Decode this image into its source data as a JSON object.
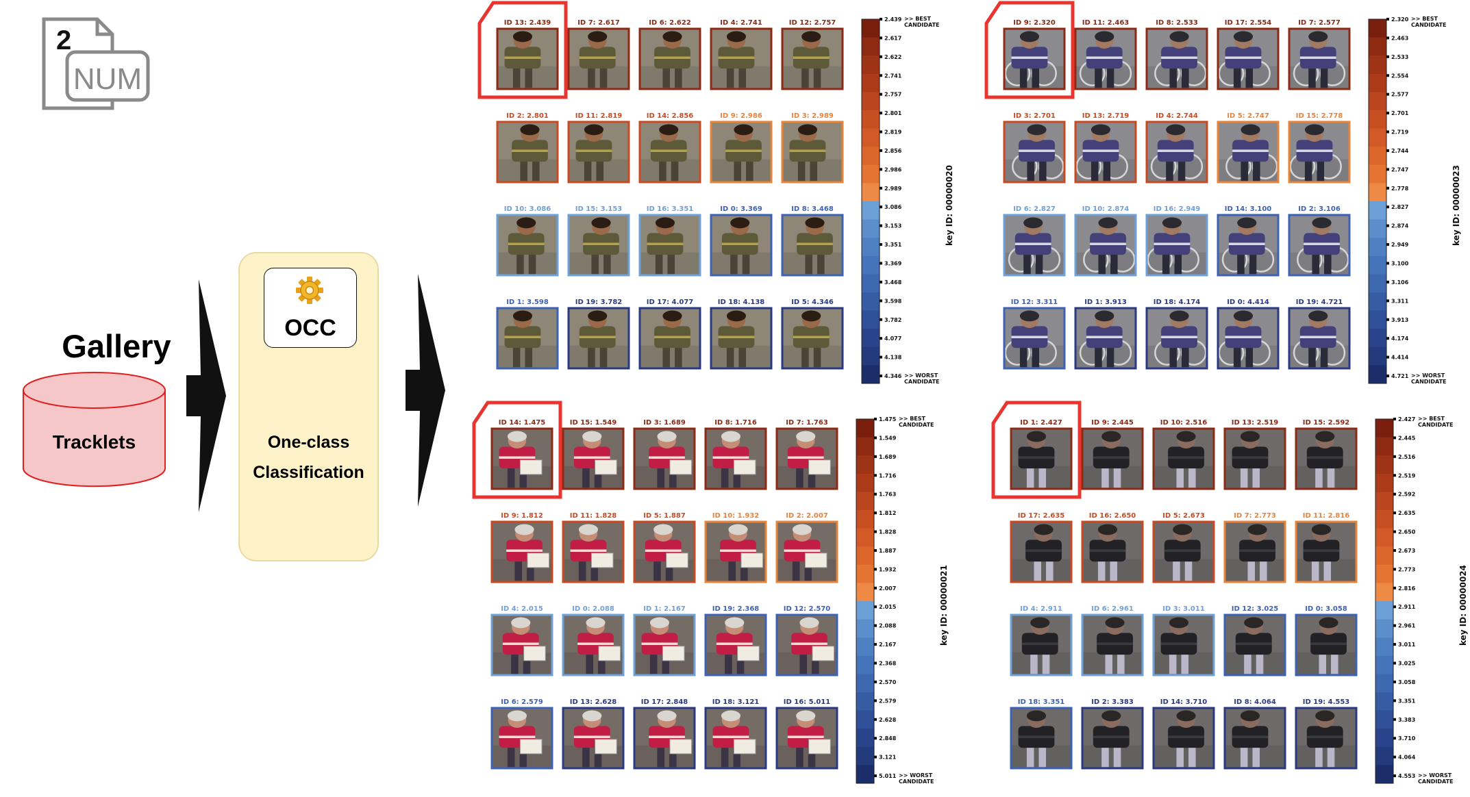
{
  "badge": {
    "number": "2",
    "text": "NUM"
  },
  "gallery": {
    "title": "Gallery",
    "db_label": "Tracklets"
  },
  "occ": {
    "chip_label": "OCC",
    "line1": "One-class",
    "line2": "Classification"
  },
  "colorbar": {
    "best_label_1": ">> BEST",
    "best_label_2": "CANDIDATE",
    "worst_label_1": ">> WORST",
    "worst_label_2": "CANDIDATE"
  },
  "colors": {
    "border_dark_red": "#8b2a15",
    "border_red": "#c84a22",
    "border_orange": "#e8833a",
    "border_light_blue": "#6fa0d6",
    "border_blue": "#3c62b4",
    "border_navy": "#2a3a82",
    "highlight": "#e8352f"
  },
  "panels": [
    {
      "key_id": "key ID: 00000020",
      "theme": "brown",
      "cells": [
        [
          "ID 13:  2.439",
          "ID 7:  2.617",
          "ID 6:  2.622",
          "ID 4:  2.741",
          "ID 12:  2.757"
        ],
        [
          "ID 2:  2.801",
          "ID 11:  2.819",
          "ID 14:  2.856",
          "ID 9:  2.986",
          "ID 3:  2.989"
        ],
        [
          "ID 10:  3.086",
          "ID 15:  3.153",
          "ID 16:  3.351",
          "ID 0:  3.369",
          "ID 8:  3.468"
        ],
        [
          "ID 1:  3.598",
          "ID 19:  3.782",
          "ID 17:  4.077",
          "ID 18:  4.138",
          "ID 5:  4.346"
        ]
      ],
      "ticks": [
        "2.439",
        "2.617",
        "2.622",
        "2.741",
        "2.757",
        "2.801",
        "2.819",
        "2.856",
        "2.986",
        "2.989",
        "3.086",
        "3.153",
        "3.351",
        "3.369",
        "3.468",
        "3.598",
        "3.782",
        "4.077",
        "4.138",
        "4.346"
      ]
    },
    {
      "key_id": "key ID: 00000023",
      "theme": "bike",
      "cells": [
        [
          "ID 9:  2.320",
          "ID 11:  2.463",
          "ID 8:  2.533",
          "ID 17:  2.554",
          "ID 7:  2.577"
        ],
        [
          "ID 3:  2.701",
          "ID 13:  2.719",
          "ID 4:  2.744",
          "ID 5:  2.747",
          "ID 15:  2.778"
        ],
        [
          "ID 6:  2.827",
          "ID 10:  2.874",
          "ID 16:  2.949",
          "ID 14:  3.100",
          "ID 2:  3.106"
        ],
        [
          "ID 12:  3.311",
          "ID 1:  3.913",
          "ID 18:  4.174",
          "ID 0:  4.414",
          "ID 19:  4.721"
        ]
      ],
      "ticks": [
        "2.320",
        "2.463",
        "2.533",
        "2.554",
        "2.577",
        "2.701",
        "2.719",
        "2.744",
        "2.747",
        "2.778",
        "2.827",
        "2.874",
        "2.949",
        "3.100",
        "3.106",
        "3.311",
        "3.913",
        "4.174",
        "4.414",
        "4.721"
      ]
    },
    {
      "key_id": "key ID: 00000021",
      "theme": "red",
      "cells": [
        [
          "ID 14:  1.475",
          "ID 15:  1.549",
          "ID 3:  1.689",
          "ID 8:  1.716",
          "ID 7:  1.763"
        ],
        [
          "ID 9:  1.812",
          "ID 11:  1.828",
          "ID 5:  1.887",
          "ID 10:  1.932",
          "ID 2:  2.007"
        ],
        [
          "ID 4:  2.015",
          "ID 0:  2.088",
          "ID 1:  2.167",
          "ID 19:  2.368",
          "ID 12:  2.570"
        ],
        [
          "ID 6:  2.579",
          "ID 13:  2.628",
          "ID 17:  2.848",
          "ID 18:  3.121",
          "ID 16:  5.011"
        ]
      ],
      "ticks": [
        "1.475",
        "1.549",
        "1.689",
        "1.716",
        "1.763",
        "1.812",
        "1.828",
        "1.887",
        "1.932",
        "2.007",
        "2.015",
        "2.088",
        "2.167",
        "2.368",
        "2.570",
        "2.579",
        "2.628",
        "2.848",
        "3.121",
        "5.011"
      ]
    },
    {
      "key_id": "key ID: 00000024",
      "theme": "dark",
      "cells": [
        [
          "ID 1:  2.427",
          "ID 9:  2.445",
          "ID 10:  2.516",
          "ID 13:  2.519",
          "ID 15:  2.592"
        ],
        [
          "ID 17:  2.635",
          "ID 16:  2.650",
          "ID 5:  2.673",
          "ID 7:  2.773",
          "ID 11:  2.816"
        ],
        [
          "ID 4:  2.911",
          "ID 6:  2.961",
          "ID 3:  3.011",
          "ID 12:  3.025",
          "ID 0:  3.058"
        ],
        [
          "ID 18:  3.351",
          "ID 2:  3.383",
          "ID 14:  3.710",
          "ID 8:  4.064",
          "ID 19:  4.553"
        ]
      ],
      "ticks": [
        "2.427",
        "2.445",
        "2.516",
        "2.519",
        "2.592",
        "2.635",
        "2.650",
        "2.673",
        "2.773",
        "2.816",
        "2.911",
        "2.961",
        "3.011",
        "3.025",
        "3.058",
        "3.351",
        "3.383",
        "3.710",
        "4.064",
        "4.553"
      ]
    }
  ]
}
